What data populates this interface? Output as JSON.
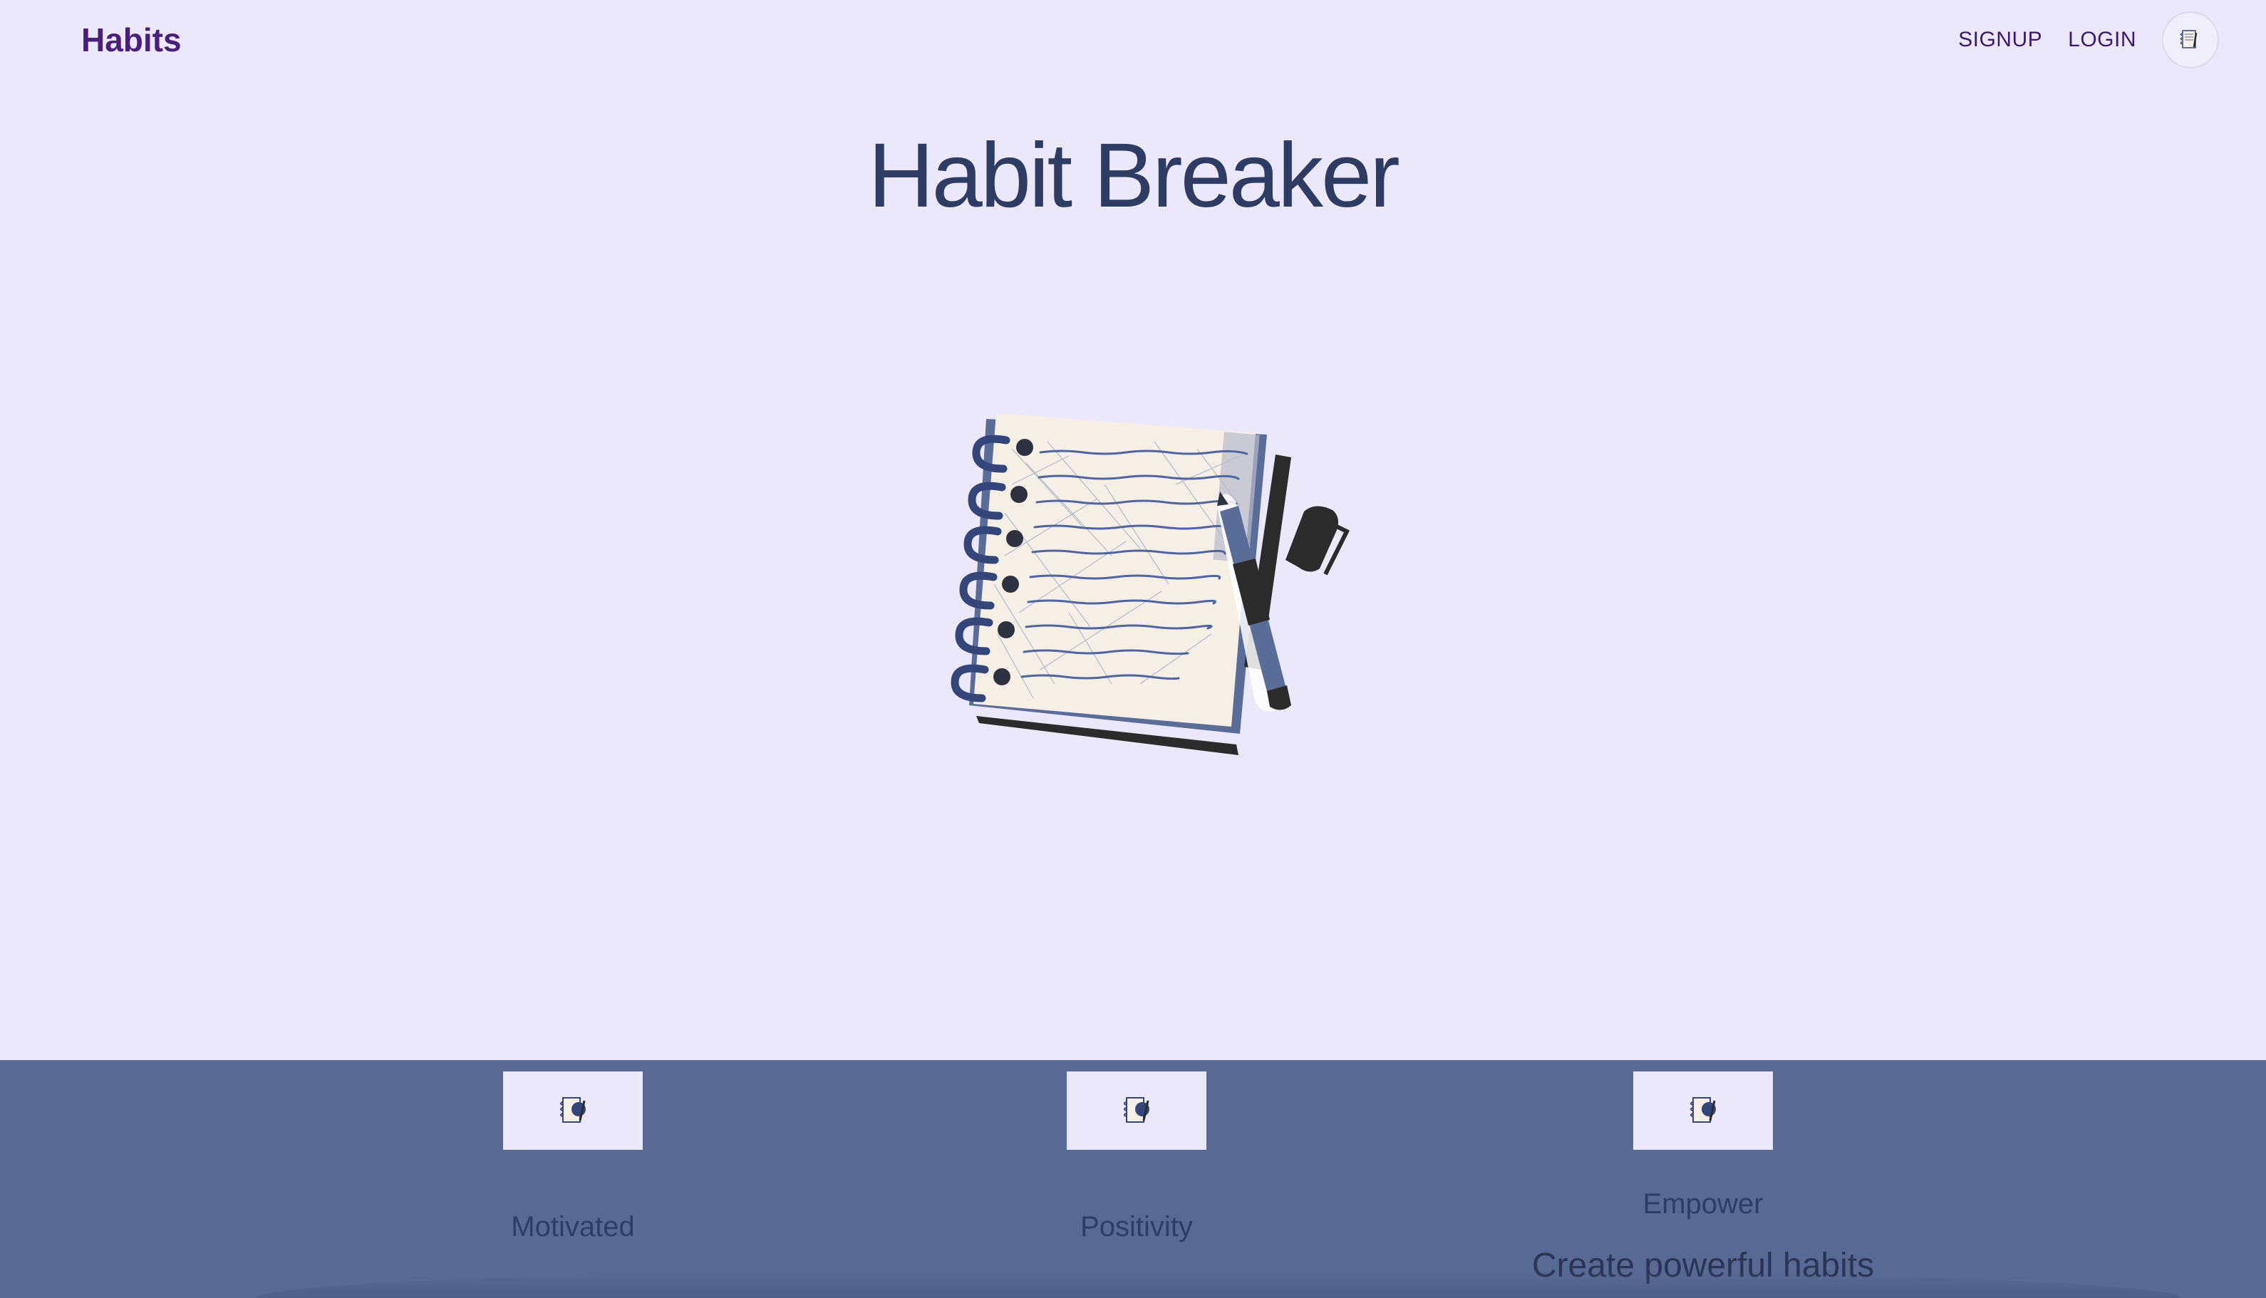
{
  "nav": {
    "brand": "Habits",
    "links": [
      "SIGNUP",
      "LOGIN"
    ],
    "avatar_icon": "notebook-icon"
  },
  "hero": {
    "title": "Habit Breaker",
    "illustration": "notebook-with-pen-illustration"
  },
  "features": [
    {
      "label": "Motivated",
      "icon": "notebook-icon"
    },
    {
      "label": "Positivity",
      "icon": "notebook-icon"
    },
    {
      "label": "Empower",
      "icon": "notebook-icon",
      "description": "Create powerful habits"
    }
  ],
  "colors": {
    "page_bg": "#ece8fb",
    "brand": "#4a1f7a",
    "title": "#2e3b62",
    "feature_band": "#586a94",
    "notebook_blue": "#34457a",
    "paper": "#f6efe6",
    "ink": "#2b2b2b"
  }
}
